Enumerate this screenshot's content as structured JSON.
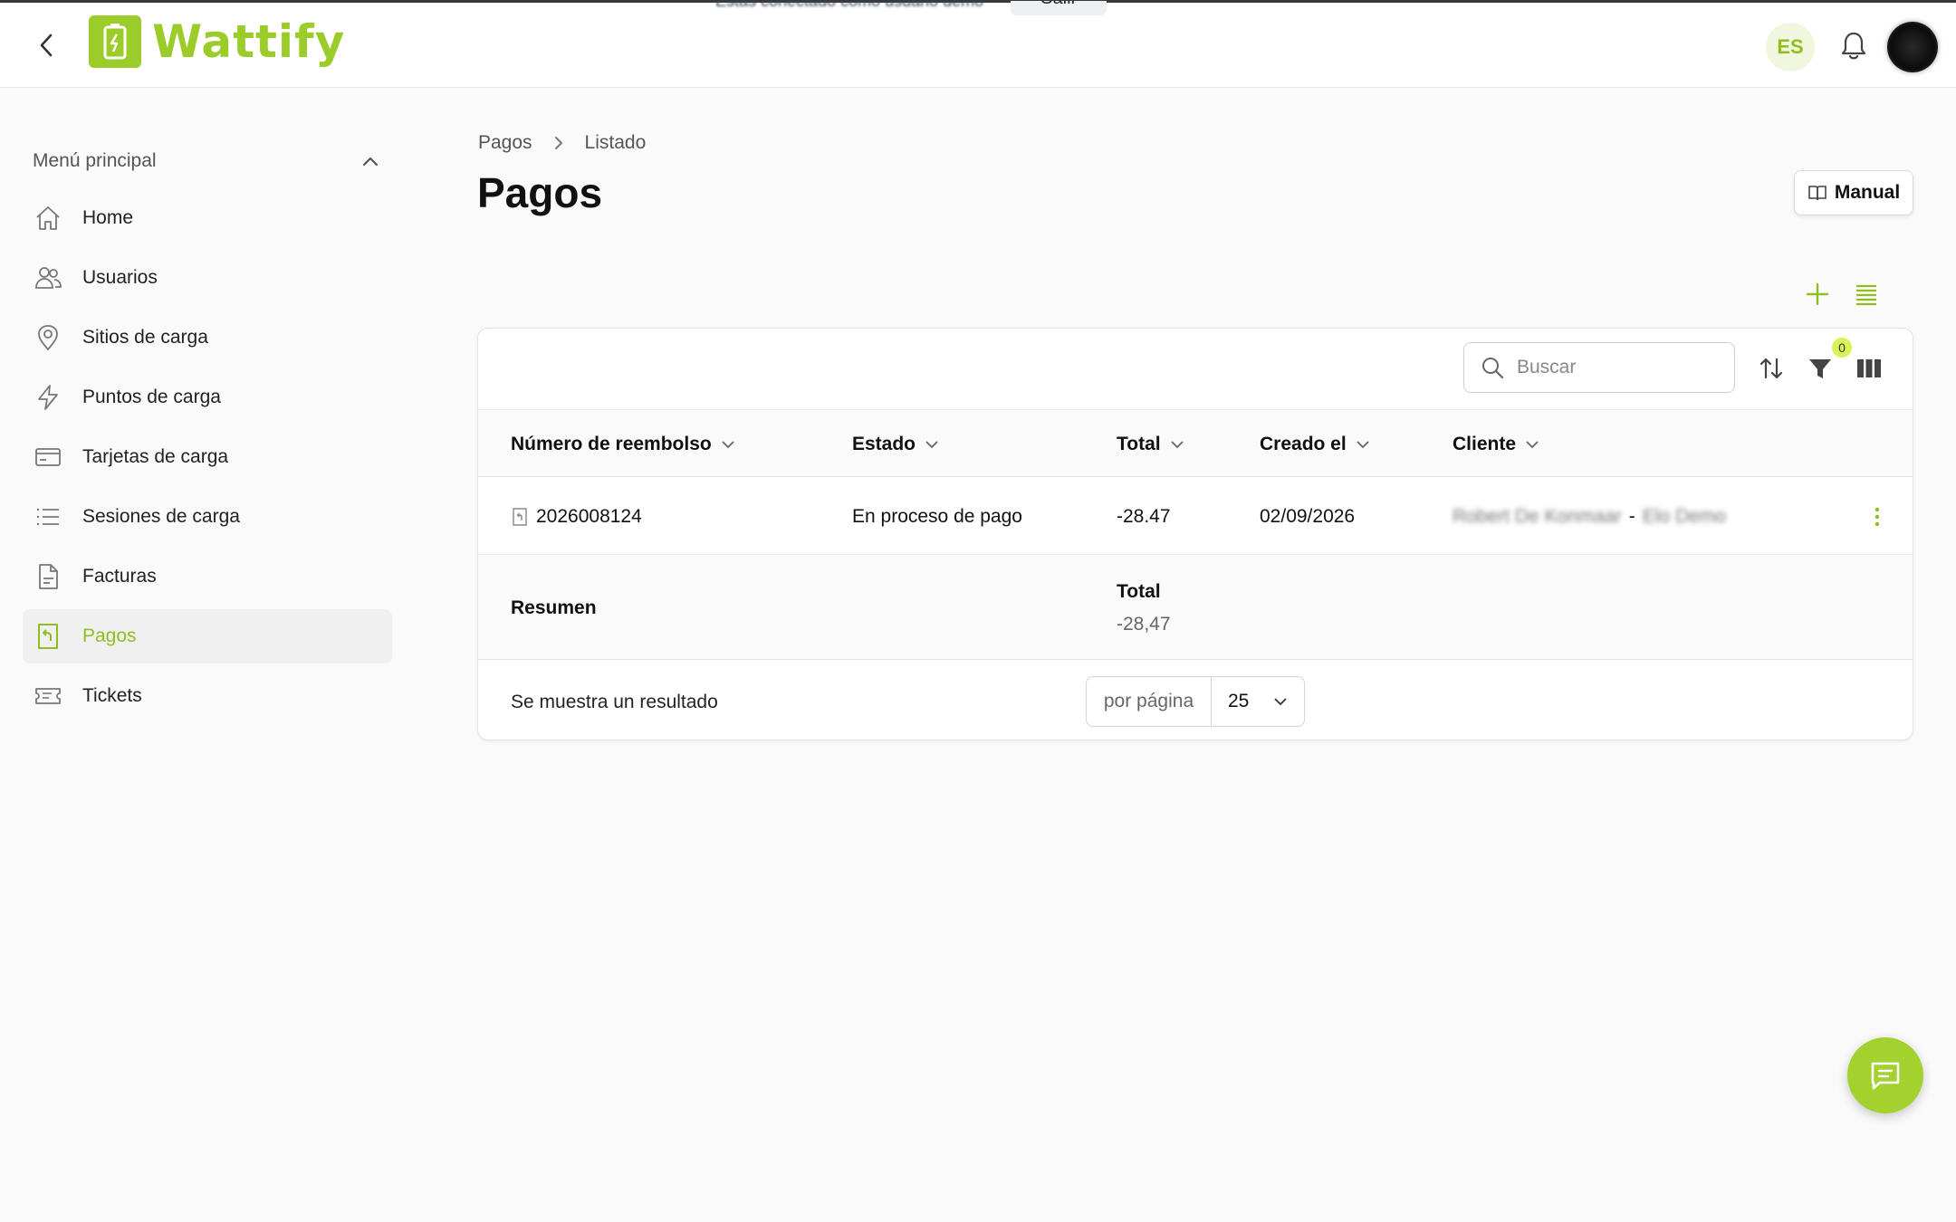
{
  "header": {
    "brand": "Wattify",
    "top_strip_text": "Estás conectado como usuario demo",
    "top_strip_button": "Salir",
    "language": "ES"
  },
  "sidebar": {
    "menu_label": "Menú principal",
    "items": [
      {
        "label": "Home",
        "icon": "home-icon"
      },
      {
        "label": "Usuarios",
        "icon": "users-icon"
      },
      {
        "label": "Sitios de carga",
        "icon": "map-pin-icon"
      },
      {
        "label": "Puntos de carga",
        "icon": "lightning-icon"
      },
      {
        "label": "Tarjetas de carga",
        "icon": "card-icon"
      },
      {
        "label": "Sesiones de carga",
        "icon": "list-icon"
      },
      {
        "label": "Facturas",
        "icon": "document-icon"
      },
      {
        "label": "Pagos",
        "icon": "refund-icon",
        "active": true
      },
      {
        "label": "Tickets",
        "icon": "ticket-icon"
      }
    ]
  },
  "breadcrumb": {
    "parent": "Pagos",
    "current": "Listado"
  },
  "page": {
    "title": "Pagos",
    "manual_label": "Manual"
  },
  "toolbar": {
    "search_placeholder": "Buscar",
    "filter_count": "0"
  },
  "table": {
    "columns": [
      "Número de reembolso",
      "Estado",
      "Total",
      "Creado el",
      "Cliente"
    ],
    "rows": [
      {
        "refund_number": "2026008124",
        "status": "En proceso de pago",
        "total": "-28.47",
        "created": "02/09/2026",
        "client_name": "Robert De Konmaar",
        "client_separator": "-",
        "client_company": "Elo Demo"
      }
    ]
  },
  "summary": {
    "label": "Resumen",
    "total_label": "Total",
    "total_value": "-28,47"
  },
  "footer": {
    "results_text": "Se muestra un resultado",
    "per_page_label": "por página",
    "per_page_value": "25"
  },
  "colors": {
    "accent": "#9ccc2a",
    "accent_text": "#8fbf1f",
    "badge": "#d9f25a"
  }
}
